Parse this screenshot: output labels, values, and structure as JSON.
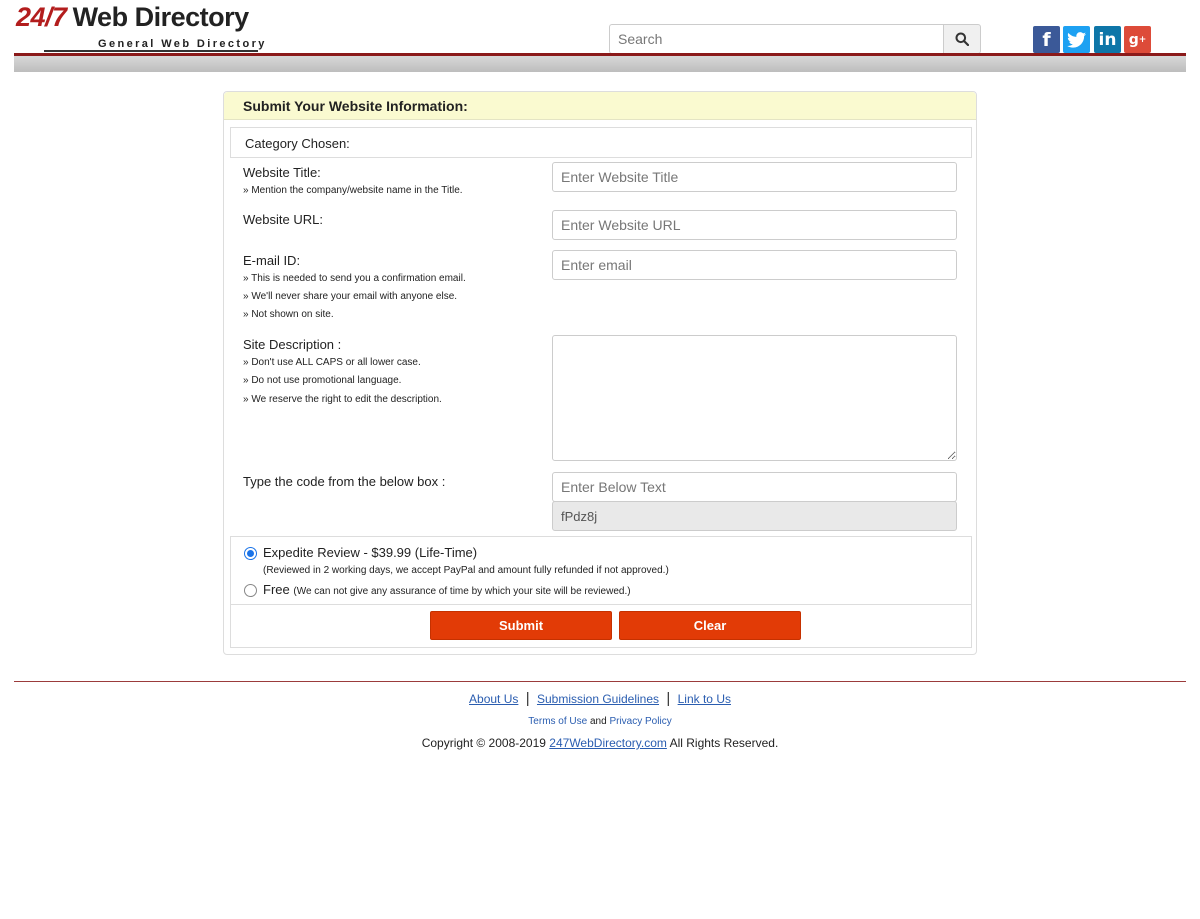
{
  "header": {
    "logo_number": "24/7",
    "logo_text": "Web Directory",
    "logo_subtitle": "General Web Directory",
    "search_placeholder": "Search",
    "social": [
      "facebook-icon",
      "twitter-icon",
      "linkedin-icon",
      "google-plus-icon"
    ],
    "colors": {
      "brand_red": "#8b1a1a",
      "facebook": "#3b5998",
      "twitter": "#1da1f2",
      "linkedin": "#0e76a8",
      "google_plus": "#dd4b39"
    }
  },
  "form": {
    "title": "Submit Your Website Information:",
    "category_label": "Category Chosen:",
    "website_title": {
      "label": "Website Title:",
      "hint": "» Mention the company/website name in the Title.",
      "placeholder": "Enter Website Title"
    },
    "website_url": {
      "label": "Website URL:",
      "placeholder": "Enter Website URL"
    },
    "email": {
      "label": "E-mail ID:",
      "hints": [
        "» This is needed to send you a confirmation email.",
        "» We'll never share your email with anyone else.",
        "» Not shown on site."
      ],
      "placeholder": "Enter email"
    },
    "description": {
      "label": "Site Description :",
      "hints": [
        "» Don't use ALL CAPS or all lower case.",
        "» Do not use promotional language.",
        "» We reserve the right to edit the description."
      ]
    },
    "captcha": {
      "label": "Type the code from the below box :",
      "placeholder": "Enter Below Text",
      "code": "fPdz8j"
    },
    "options": {
      "expedite_label": "Expedite Review - $39.99 (Life-Time)",
      "expedite_note": "(Reviewed in 2 working days, we accept PayPal and amount fully refunded if not approved.)",
      "free_label": "Free",
      "free_note": "(We can not give any assurance of time by which your site will be reviewed.)",
      "selected": "expedite"
    },
    "submit_label": "Submit",
    "clear_label": "Clear",
    "button_color": "#e23b06"
  },
  "footer": {
    "about": "About Us",
    "guidelines": "Submission Guidelines",
    "link_to_us": "Link to Us",
    "separator": "|",
    "terms": "Terms of Use",
    "and": "and",
    "privacy": "Privacy Policy",
    "copyright_prefix": "Copyright © 2008-2019",
    "site_link": "247WebDirectory.com",
    "copyright_suffix": "All Rights Reserved."
  }
}
